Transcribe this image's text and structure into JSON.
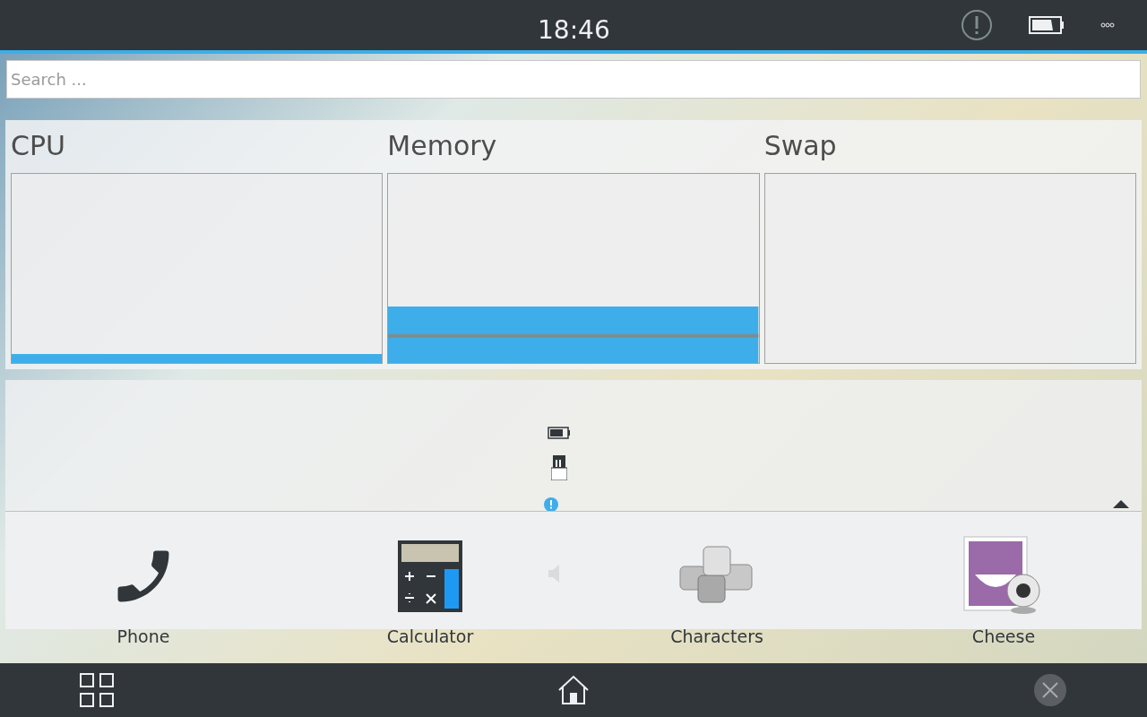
{
  "status_bar": {
    "time": "18:46"
  },
  "search": {
    "placeholder": "Search ..."
  },
  "monitors": [
    {
      "title": "CPU"
    },
    {
      "title": "Memory"
    },
    {
      "title": "Swap"
    }
  ],
  "apps": [
    {
      "kind": "phone",
      "label": "Phone"
    },
    {
      "kind": "calculator",
      "label": "Calculator"
    },
    {
      "kind": "characters",
      "label": "Characters"
    },
    {
      "kind": "cheese",
      "label": "Cheese"
    }
  ]
}
